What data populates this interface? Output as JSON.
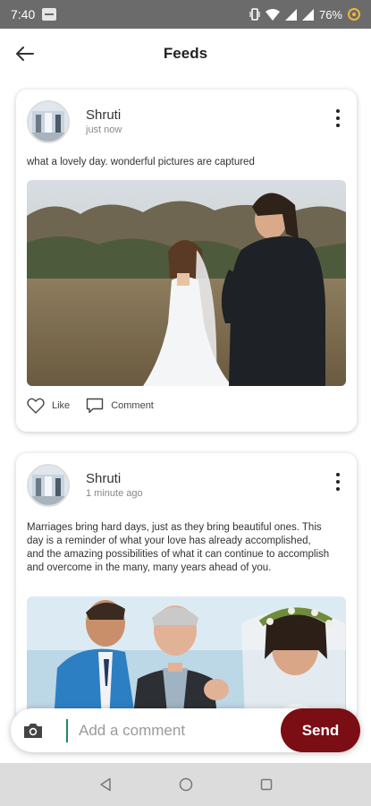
{
  "status_bar": {
    "time": "7:40",
    "battery": "76%"
  },
  "header": {
    "title": "Feeds"
  },
  "posts": [
    {
      "author": "Shruti",
      "time": "just now",
      "caption": "what a lovely day. wonderful pictures are captured",
      "like_label": "Like",
      "comment_label": "Comment"
    },
    {
      "author": "Shruti",
      "time": "1 minute ago",
      "caption": "Marriages bring hard days, just as they bring beautiful ones. This day is a reminder of what your love has already accomplished, and the amazing possibilities of what it can continue to accomplish and overcome in the many, many years ahead of you."
    }
  ],
  "comment_bar": {
    "placeholder": "Add a comment",
    "send_label": "Send"
  },
  "colors": {
    "send_button": "#7a0e14",
    "status_bar": "#6b6b6b",
    "nav_bar": "#dcdcdc"
  }
}
